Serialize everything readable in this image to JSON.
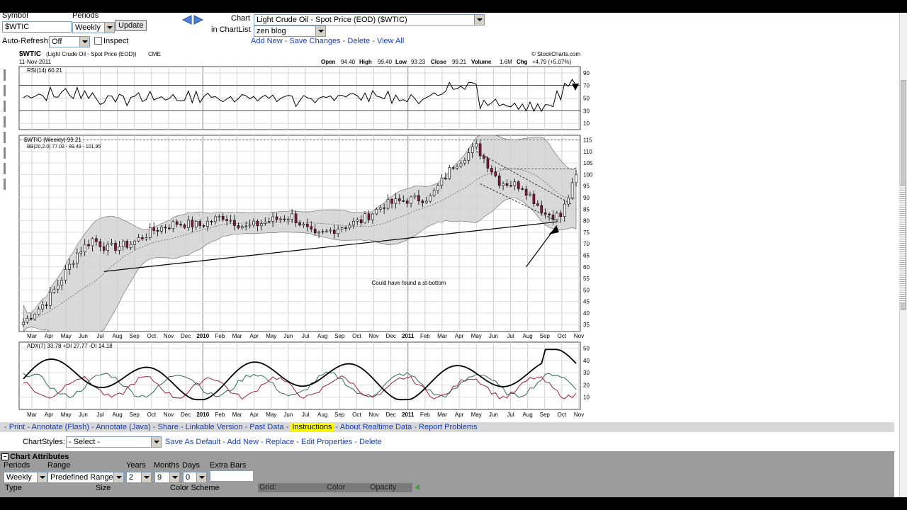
{
  "toolbar": {
    "symbol_label": "Symbol",
    "symbol_value": "$WTIC",
    "periods_label": "Periods",
    "periods_value": "Weekly",
    "update_label": "Update",
    "autorefresh_label": "Auto-Refresh:",
    "autorefresh_value": "Off",
    "inspect_label": "Inspect",
    "chart_label": "Chart",
    "chartlist_label": "in ChartList",
    "chart_value": "Light Crude Oil - Spot Price (EOD) ($WTIC)",
    "chartlist_value": "zen blog",
    "actions": [
      "Add New",
      "Save Changes",
      "Delete",
      "View All"
    ]
  },
  "chart": {
    "symbol": "$WTIC",
    "name": "(Light Crude Oil - Spot Price (EOD))",
    "exchange": "CME",
    "date": "11-Nov-2011",
    "provider": "© StockCharts.com",
    "open_label": "Open",
    "open": "94.40",
    "high_label": "High",
    "high": "99.40",
    "low_label": "Low",
    "low": "93.23",
    "close_label": "Close",
    "close": "99.21",
    "volume_label": "Volume",
    "volume": "1.6M",
    "chg_label": "Chg",
    "chg": "+4.79 (+5.07%)",
    "rsi_title": "RSI(14) 60.21",
    "price_title": "$WTIC (Weekly) 99.21",
    "bb_title": "BB(20,2.0) 77.03 - 89.49 - 101.95",
    "adx_title": "ADX(7) 33.78 +DI 27.77 -DI 14.18",
    "annotation": "Could have found a st-bottom",
    "rsi_ticks": [
      "90",
      "70",
      "50",
      "30",
      "10"
    ],
    "price_ticks": [
      "115",
      "110",
      "105",
      "100",
      "95",
      "90",
      "85",
      "80",
      "75",
      "70",
      "65",
      "60",
      "55",
      "50",
      "45",
      "40",
      "35"
    ],
    "adx_ticks": [
      "50",
      "40",
      "30",
      "20",
      "10"
    ],
    "months": [
      "Mar",
      "Apr",
      "May",
      "Jun",
      "Jul",
      "Aug",
      "Sep",
      "Oct",
      "Nov",
      "Dec",
      "2010",
      "Feb",
      "Mar",
      "Apr",
      "May",
      "Jun",
      "Jul",
      "Aug",
      "Sep",
      "Oct",
      "Nov",
      "Dec",
      "2011",
      "Feb",
      "Mar",
      "Apr",
      "May",
      "Jun",
      "Jul",
      "Aug",
      "Sep",
      "Oct",
      "Nov"
    ],
    "colors": {
      "up": "#ffffff",
      "down": "#8b1a3a",
      "band": "#cfcfcf",
      "adx": "#000000",
      "plus_di": "#2e6b4f",
      "minus_di": "#9b2040"
    }
  },
  "linkbar": [
    "Print",
    "Annotate (Flash)",
    "Annotate (Java)",
    "Share",
    "Linkable Version",
    "Past Data",
    "Instructions",
    "About Realtime Data",
    "Report Problems"
  ],
  "chartstyles": {
    "label": "ChartStyles:",
    "select_value": "- Select -",
    "actions": [
      "Save As Default",
      "Add New",
      "Replace",
      "Edit Properties",
      "Delete"
    ]
  },
  "attributes": {
    "title": "Chart Attributes",
    "periods_label": "Periods",
    "periods_value": "Weekly",
    "range_label": "Range",
    "range_value": "Predefined Range",
    "years_label": "Years",
    "years_value": "2",
    "months_label": "Months",
    "months_value": "9",
    "days_label": "Days",
    "days_value": "0",
    "extrabars_label": "Extra Bars",
    "type_label": "Type",
    "size_label": "Size",
    "colorscheme_label": "Color Scheme",
    "grid_label": "Grid:",
    "color_label": "Color",
    "opacity_label": "Opacity"
  }
}
